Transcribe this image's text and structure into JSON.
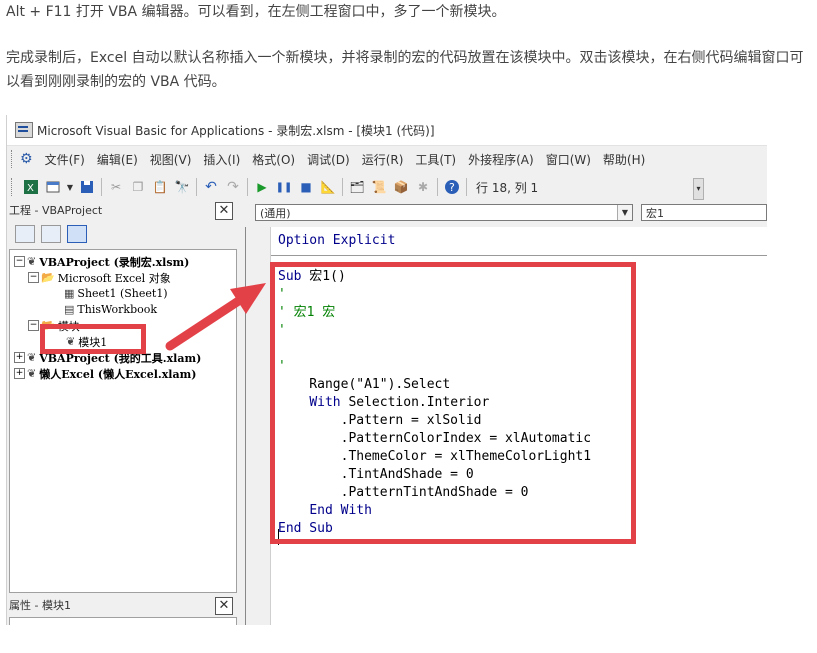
{
  "article": {
    "para1": "Alt + F11 打开 VBA 编辑器。可以看到，在左侧工程窗口中，多了一个新模块。",
    "para2": "完成录制后，Excel 自动以默认名称插入一个新模块，并将录制的宏的代码放置在该模块中。双击该模块，在右侧代码编辑窗口可以看到刚刚录制的宏的 VBA 代码。"
  },
  "window": {
    "title": "Microsoft Visual Basic for Applications - 录制宏.xlsm - [模块1 (代码)]"
  },
  "menu": [
    "文件(F)",
    "编辑(E)",
    "视图(V)",
    "插入(I)",
    "格式(O)",
    "调试(D)",
    "运行(R)",
    "工具(T)",
    "外接程序(A)",
    "窗口(W)",
    "帮助(H)"
  ],
  "toolbar": {
    "status": "行 18, 列 1",
    "icons": [
      "excel-icon",
      "insert-module-icon",
      "save-icon",
      "cut-icon",
      "copy-icon",
      "paste-icon",
      "find-icon",
      "undo-icon",
      "redo-icon",
      "run-icon",
      "break-icon",
      "reset-icon",
      "design-mode-icon",
      "project-explorer-icon",
      "properties-icon",
      "object-browser-icon",
      "toolbox-icon",
      "help-icon"
    ]
  },
  "project_pane": {
    "title": "工程 - VBAProject",
    "close": "✕",
    "tree": {
      "root1": "VBAProject (录制宏.xlsm)",
      "excel_objects": "Microsoft Excel 对象",
      "sheet1": "Sheet1 (Sheet1)",
      "thisworkbook": "ThisWorkbook",
      "modules": "模块",
      "module1": "模块1",
      "root2": "VBAProject (我的工具.xlam)",
      "root3": "懒人Excel (懒人Excel.xlam)"
    }
  },
  "properties_pane": {
    "title": "属性 - 模块1",
    "close": "✕"
  },
  "code_window": {
    "object_combo": "(通用)",
    "proc_combo": "宏1",
    "option_line": "Option Explicit",
    "lines": [
      "Sub 宏1()",
      "'",
      "' 宏1 宏",
      "'",
      "",
      "'",
      "    Range(\"A1\").Select",
      "    With Selection.Interior",
      "        .Pattern = xlSolid",
      "        .PatternColorIndex = xlAutomatic",
      "        .ThemeColor = xlThemeColorLight1",
      "        .TintAndShade = 0",
      "        .PatternTintAndShade = 0",
      "    End With",
      "End Sub"
    ]
  },
  "colors": {
    "highlight": "#e34148",
    "keyword": "#00008b",
    "comment": "#008000"
  }
}
